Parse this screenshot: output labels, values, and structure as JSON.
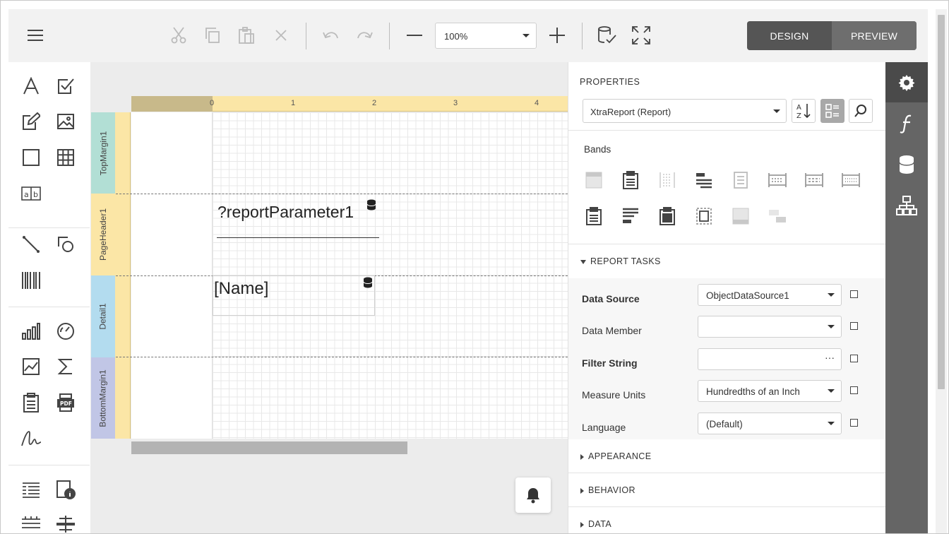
{
  "toolbar": {
    "zoom_value": "100%",
    "design_label": "DESIGN",
    "preview_label": "PREVIEW"
  },
  "surface": {
    "ruler_numbers": [
      "0",
      "1",
      "2",
      "3",
      "4"
    ],
    "bands": [
      "TopMargin1",
      "PageHeader1",
      "Detail1",
      "BottomMargin1"
    ],
    "parameter_text": "?reportParameter1",
    "name_text": "[Name]"
  },
  "properties": {
    "title": "PROPERTIES",
    "selected_object": "XtraReport (Report)",
    "bands_title": "Bands",
    "report_tasks_title": "REPORT TASKS",
    "rows": [
      {
        "label": "Data Source",
        "value": "ObjectDataSource1",
        "bold": true
      },
      {
        "label": "Data Member",
        "value": "",
        "bold": false
      },
      {
        "label": "Filter String",
        "value": "",
        "bold": true
      },
      {
        "label": "Measure Units",
        "value": "Hundredths of an Inch",
        "bold": false
      },
      {
        "label": "Language",
        "value": "(Default)",
        "bold": false
      }
    ],
    "filter_ellipsis": "···",
    "sections": [
      "APPEARANCE",
      "BEHAVIOR",
      "DATA"
    ]
  },
  "colors": {
    "band_topmargin": "#b2dfd5",
    "band_pageheader": "#fbe6a6",
    "band_detail": "#b3dcef",
    "band_bottommargin": "#c1c6e6",
    "side_tabs_bg": "#656565",
    "mode_active": "#555555"
  },
  "icons": {
    "toolbar": [
      "menu-icon",
      "cut-icon",
      "copy-icon",
      "paste-icon",
      "delete-icon",
      "undo-icon",
      "redo-icon",
      "zoom-out-icon",
      "zoom-in-icon",
      "validate-icon",
      "fullscreen-icon"
    ],
    "side_tabs": [
      "gear-icon",
      "function-icon",
      "database-icon",
      "hierarchy-icon"
    ]
  }
}
